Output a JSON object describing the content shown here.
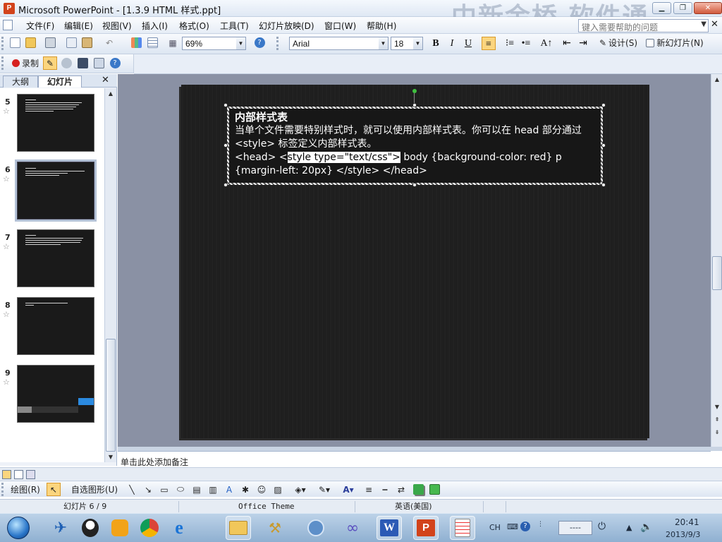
{
  "window": {
    "title": "Microsoft PowerPoint - [1.3.9 HTML 样式.ppt]",
    "watermark": "中新金桥  软件通",
    "app_icon": "P",
    "controls": {
      "minimize": "▁",
      "maximize": "❐",
      "close": "✕"
    }
  },
  "menu": {
    "items": [
      "文件(F)",
      "编辑(E)",
      "视图(V)",
      "插入(I)",
      "格式(O)",
      "工具(T)",
      "幻灯片放映(D)",
      "窗口(W)",
      "帮助(H)"
    ],
    "help_placeholder": "键入需要帮助的问题",
    "doc_close": "✕"
  },
  "toolbar": {
    "zoom": "69%",
    "font": "Arial",
    "size": "18",
    "bold": "B",
    "italic": "I",
    "underline": "U",
    "design_label": "设计(S)",
    "new_slide_label": "新幻灯片(N)",
    "record_label": "录制"
  },
  "panel": {
    "tabs": [
      "大纲",
      "幻灯片"
    ],
    "close": "✕",
    "slides": [
      {
        "num": "5",
        "star": "☆"
      },
      {
        "num": "6",
        "star": "☆"
      },
      {
        "num": "7",
        "star": "☆"
      },
      {
        "num": "8",
        "star": "☆"
      },
      {
        "num": "9",
        "star": "☆"
      }
    ]
  },
  "slide": {
    "heading": "内部样式表",
    "line1": "当单个文件需要特别样式时，就可以使用内部样式表。你可以在 head 部分通过 <style> 标签定义内部样式表。",
    "line2_a": "<head> <",
    "line2_sel": "style type=\"text/css\">",
    "line2_b": " body {background-color: red} p {margin-left: 20px} </style> </head>"
  },
  "notes": {
    "placeholder": "单击此处添加备注"
  },
  "drawing": {
    "draw_label": "绘图(R)",
    "autoshape_label": "自选图形(U)"
  },
  "status": {
    "slide_info": "幻灯片 6 / 9",
    "theme": "Office Theme",
    "language": "英语(美国)"
  },
  "taskbar": {
    "lang": "CH",
    "time": "20:41",
    "date": "2013/9/3",
    "ime": "----"
  },
  "colors": {
    "accent": "#2b8ae0",
    "slide_bg": "#1e1e1e",
    "canvas_bg": "#8a91a4"
  }
}
